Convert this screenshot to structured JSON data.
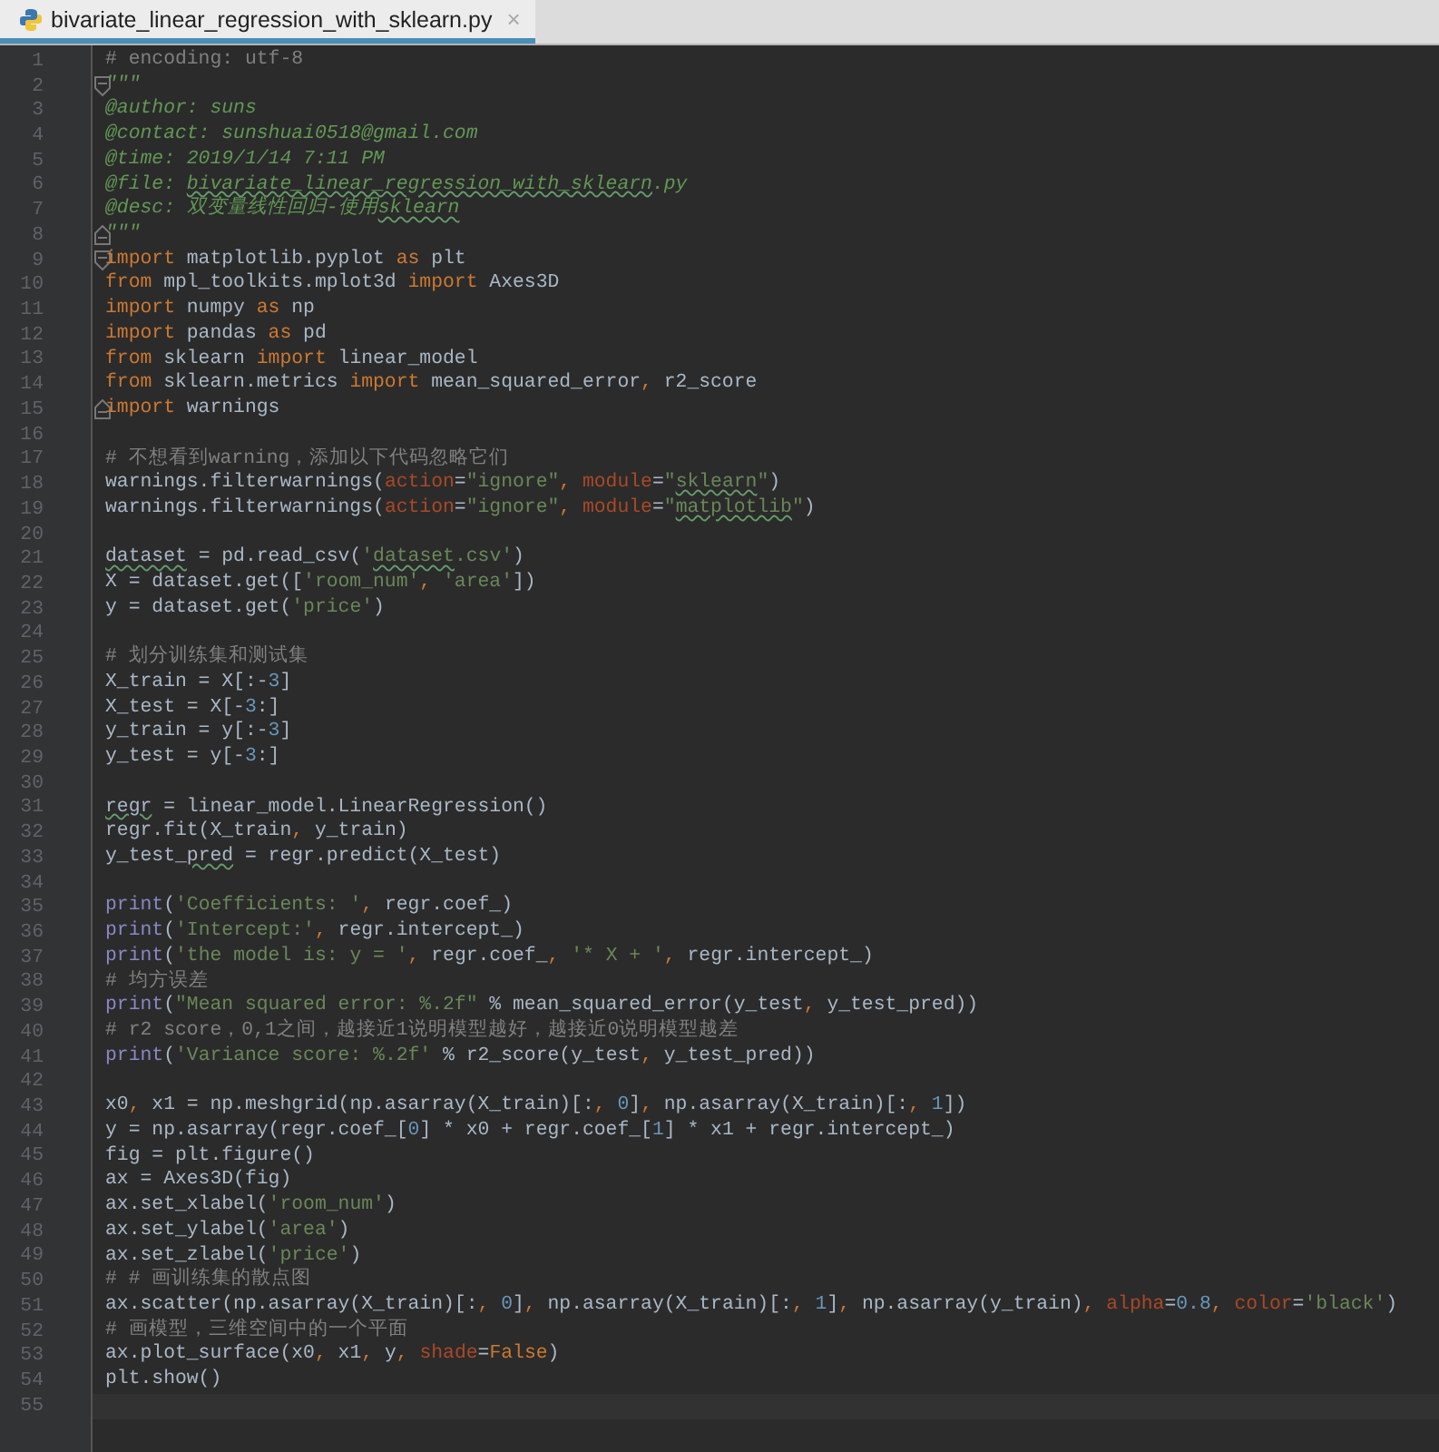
{
  "tabs": [
    {
      "label": "bivariate_linear_regression_with_sklearn.py",
      "close": "×",
      "selected": true
    }
  ],
  "lines": [
    {
      "n": "1",
      "tokens": [
        {
          "kind": "comment",
          "text": "# encoding: utf-8"
        }
      ]
    },
    {
      "n": "2",
      "fold_start": true,
      "tokens": [
        {
          "kind": "docstring",
          "text": "\"\"\""
        }
      ]
    },
    {
      "n": "3",
      "tokens": [
        {
          "kind": "docstring",
          "text": "@author: suns"
        }
      ]
    },
    {
      "n": "4",
      "tokens": [
        {
          "kind": "docstring",
          "text": "@contact: sunshuai0518@gmail.com"
        }
      ]
    },
    {
      "n": "5",
      "tokens": [
        {
          "kind": "docstring",
          "text": "@time: 2019/1/14 7:11 PM"
        }
      ]
    },
    {
      "n": "6",
      "tokens": [
        {
          "kind": "docstring",
          "text": "@file: "
        },
        {
          "kind": "docstring_typo",
          "text": "bivariate_linear_regression_with_sklearn"
        },
        {
          "kind": "docstring",
          "text": ".py"
        }
      ]
    },
    {
      "n": "7",
      "tokens": [
        {
          "kind": "docstring",
          "text": "@desc: 双变量线性回归-使用"
        },
        {
          "kind": "docstring_typo",
          "text": "sklearn"
        }
      ]
    },
    {
      "n": "8",
      "fold_end": true,
      "tokens": [
        {
          "kind": "docstring",
          "text": "\"\"\""
        }
      ]
    },
    {
      "n": "9",
      "fold_start": true,
      "tokens": [
        {
          "kind": "keyword",
          "text": "import"
        },
        {
          "kind": "plain",
          "text": " matplotlib.pyplot "
        },
        {
          "kind": "keyword",
          "text": "as"
        },
        {
          "kind": "plain",
          "text": " plt"
        }
      ]
    },
    {
      "n": "10",
      "tokens": [
        {
          "kind": "keyword",
          "text": "from"
        },
        {
          "kind": "plain",
          "text": " mpl_toolkits.mplot3d "
        },
        {
          "kind": "keyword",
          "text": "import"
        },
        {
          "kind": "plain",
          "text": " Axes3D"
        }
      ]
    },
    {
      "n": "11",
      "tokens": [
        {
          "kind": "keyword",
          "text": "import"
        },
        {
          "kind": "plain",
          "text": " numpy "
        },
        {
          "kind": "keyword",
          "text": "as"
        },
        {
          "kind": "plain",
          "text": " np"
        }
      ]
    },
    {
      "n": "12",
      "tokens": [
        {
          "kind": "keyword",
          "text": "import"
        },
        {
          "kind": "plain",
          "text": " pandas "
        },
        {
          "kind": "keyword",
          "text": "as"
        },
        {
          "kind": "plain",
          "text": " pd"
        }
      ]
    },
    {
      "n": "13",
      "tokens": [
        {
          "kind": "keyword",
          "text": "from"
        },
        {
          "kind": "plain",
          "text": " sklearn "
        },
        {
          "kind": "keyword",
          "text": "import"
        },
        {
          "kind": "plain",
          "text": " linear_model"
        }
      ]
    },
    {
      "n": "14",
      "tokens": [
        {
          "kind": "keyword",
          "text": "from"
        },
        {
          "kind": "plain",
          "text": " sklearn.metrics "
        },
        {
          "kind": "keyword",
          "text": "import"
        },
        {
          "kind": "plain",
          "text": " mean_squared_error"
        },
        {
          "kind": "keyword",
          "text": ","
        },
        {
          "kind": "plain",
          "text": " r2_score"
        }
      ]
    },
    {
      "n": "15",
      "fold_end": true,
      "tokens": [
        {
          "kind": "keyword",
          "text": "import"
        },
        {
          "kind": "plain",
          "text": " warnings"
        }
      ]
    },
    {
      "n": "16"
    },
    {
      "n": "17",
      "tokens": [
        {
          "kind": "comment",
          "text": "# 不想看到warning，添加以下代码忽略它们"
        }
      ]
    },
    {
      "n": "18",
      "tokens": [
        {
          "kind": "plain",
          "text": "warnings.filterwarnings("
        },
        {
          "kind": "param",
          "text": "action"
        },
        {
          "kind": "plain",
          "text": "="
        },
        {
          "kind": "string",
          "text": "\"ignore\""
        },
        {
          "kind": "keyword",
          "text": ", "
        },
        {
          "kind": "param",
          "text": "module"
        },
        {
          "kind": "plain",
          "text": "="
        },
        {
          "kind": "string",
          "text": "\""
        },
        {
          "kind": "string_typo",
          "text": "sklearn"
        },
        {
          "kind": "string",
          "text": "\""
        },
        {
          "kind": "plain",
          "text": ")"
        }
      ]
    },
    {
      "n": "19",
      "tokens": [
        {
          "kind": "plain",
          "text": "warnings.filterwarnings("
        },
        {
          "kind": "param",
          "text": "action"
        },
        {
          "kind": "plain",
          "text": "="
        },
        {
          "kind": "string",
          "text": "\"ignore\""
        },
        {
          "kind": "keyword",
          "text": ", "
        },
        {
          "kind": "param",
          "text": "module"
        },
        {
          "kind": "plain",
          "text": "="
        },
        {
          "kind": "string",
          "text": "\""
        },
        {
          "kind": "string_typo",
          "text": "matplotlib"
        },
        {
          "kind": "string",
          "text": "\""
        },
        {
          "kind": "plain",
          "text": ")"
        }
      ]
    },
    {
      "n": "20"
    },
    {
      "n": "21",
      "tokens": [
        {
          "kind": "plain_typo",
          "text": "dataset"
        },
        {
          "kind": "plain",
          "text": " = pd.read_csv("
        },
        {
          "kind": "string",
          "text": "'"
        },
        {
          "kind": "string_typo",
          "text": "dataset"
        },
        {
          "kind": "string",
          "text": ".csv'"
        },
        {
          "kind": "plain",
          "text": ")"
        }
      ]
    },
    {
      "n": "22",
      "tokens": [
        {
          "kind": "plain",
          "text": "X = dataset.get(["
        },
        {
          "kind": "string",
          "text": "'room_num'"
        },
        {
          "kind": "keyword",
          "text": ", "
        },
        {
          "kind": "string",
          "text": "'area'"
        },
        {
          "kind": "plain",
          "text": "])"
        }
      ]
    },
    {
      "n": "23",
      "tokens": [
        {
          "kind": "plain",
          "text": "y = dataset.get("
        },
        {
          "kind": "string",
          "text": "'price'"
        },
        {
          "kind": "plain",
          "text": ")"
        }
      ]
    },
    {
      "n": "24"
    },
    {
      "n": "25",
      "tokens": [
        {
          "kind": "comment",
          "text": "# 划分训练集和测试集"
        }
      ]
    },
    {
      "n": "26",
      "tokens": [
        {
          "kind": "plain",
          "text": "X_train = X[:-"
        },
        {
          "kind": "number",
          "text": "3"
        },
        {
          "kind": "plain",
          "text": "]"
        }
      ]
    },
    {
      "n": "27",
      "tokens": [
        {
          "kind": "plain",
          "text": "X_test = X[-"
        },
        {
          "kind": "number",
          "text": "3"
        },
        {
          "kind": "plain",
          "text": ":]"
        }
      ]
    },
    {
      "n": "28",
      "tokens": [
        {
          "kind": "plain",
          "text": "y_train = y[:-"
        },
        {
          "kind": "number",
          "text": "3"
        },
        {
          "kind": "plain",
          "text": "]"
        }
      ]
    },
    {
      "n": "29",
      "tokens": [
        {
          "kind": "plain",
          "text": "y_test = y[-"
        },
        {
          "kind": "number",
          "text": "3"
        },
        {
          "kind": "plain",
          "text": ":]"
        }
      ]
    },
    {
      "n": "30"
    },
    {
      "n": "31",
      "tokens": [
        {
          "kind": "plain_typo",
          "text": "regr"
        },
        {
          "kind": "plain",
          "text": " = linear_model.LinearRegression()"
        }
      ]
    },
    {
      "n": "32",
      "tokens": [
        {
          "kind": "plain",
          "text": "regr.fit(X_train"
        },
        {
          "kind": "keyword",
          "text": ","
        },
        {
          "kind": "plain",
          "text": " y_train)"
        }
      ]
    },
    {
      "n": "33",
      "tokens": [
        {
          "kind": "plain",
          "text": "y_test_"
        },
        {
          "kind": "plain_typo",
          "text": "pred"
        },
        {
          "kind": "plain",
          "text": " = regr.predict(X_test)"
        }
      ]
    },
    {
      "n": "34"
    },
    {
      "n": "35",
      "tokens": [
        {
          "kind": "builtin",
          "text": "print"
        },
        {
          "kind": "plain",
          "text": "("
        },
        {
          "kind": "string",
          "text": "'Coefficients: '"
        },
        {
          "kind": "keyword",
          "text": ","
        },
        {
          "kind": "plain",
          "text": " regr.coef_)"
        }
      ]
    },
    {
      "n": "36",
      "tokens": [
        {
          "kind": "builtin",
          "text": "print"
        },
        {
          "kind": "plain",
          "text": "("
        },
        {
          "kind": "string",
          "text": "'Intercept:'"
        },
        {
          "kind": "keyword",
          "text": ","
        },
        {
          "kind": "plain",
          "text": " regr.intercept_)"
        }
      ]
    },
    {
      "n": "37",
      "tokens": [
        {
          "kind": "builtin",
          "text": "print"
        },
        {
          "kind": "plain",
          "text": "("
        },
        {
          "kind": "string",
          "text": "'the model is: y = '"
        },
        {
          "kind": "keyword",
          "text": ","
        },
        {
          "kind": "plain",
          "text": " regr.coef_"
        },
        {
          "kind": "keyword",
          "text": ", "
        },
        {
          "kind": "string",
          "text": "'* X + '"
        },
        {
          "kind": "keyword",
          "text": ","
        },
        {
          "kind": "plain",
          "text": " regr.intercept_)"
        }
      ]
    },
    {
      "n": "38",
      "tokens": [
        {
          "kind": "comment",
          "text": "# 均方误差"
        }
      ]
    },
    {
      "n": "39",
      "tokens": [
        {
          "kind": "builtin",
          "text": "print"
        },
        {
          "kind": "plain",
          "text": "("
        },
        {
          "kind": "string",
          "text": "\"Mean squared error: %.2f\""
        },
        {
          "kind": "plain",
          "text": " % mean_squared_error(y_test"
        },
        {
          "kind": "keyword",
          "text": ","
        },
        {
          "kind": "plain",
          "text": " y_test_pred))"
        }
      ]
    },
    {
      "n": "40",
      "tokens": [
        {
          "kind": "comment",
          "text": "# r2 score，0,1之间，越接近1说明模型越好，越接近0说明模型越差"
        }
      ]
    },
    {
      "n": "41",
      "tokens": [
        {
          "kind": "builtin",
          "text": "print"
        },
        {
          "kind": "plain",
          "text": "("
        },
        {
          "kind": "string",
          "text": "'Variance score: %.2f'"
        },
        {
          "kind": "plain",
          "text": " % r2_score(y_test"
        },
        {
          "kind": "keyword",
          "text": ","
        },
        {
          "kind": "plain",
          "text": " y_test_pred))"
        }
      ]
    },
    {
      "n": "42"
    },
    {
      "n": "43",
      "tokens": [
        {
          "kind": "plain",
          "text": "x0"
        },
        {
          "kind": "keyword",
          "text": ","
        },
        {
          "kind": "plain",
          "text": " x1 = np.meshgrid(np.asarray(X_train)[:"
        },
        {
          "kind": "keyword",
          "text": ", "
        },
        {
          "kind": "number",
          "text": "0"
        },
        {
          "kind": "plain",
          "text": "]"
        },
        {
          "kind": "keyword",
          "text": ","
        },
        {
          "kind": "plain",
          "text": " np.asarray(X_train)[:"
        },
        {
          "kind": "keyword",
          "text": ", "
        },
        {
          "kind": "number",
          "text": "1"
        },
        {
          "kind": "plain",
          "text": "])"
        }
      ]
    },
    {
      "n": "44",
      "tokens": [
        {
          "kind": "plain",
          "text": "y = np.asarray(regr.coef_["
        },
        {
          "kind": "number",
          "text": "0"
        },
        {
          "kind": "plain",
          "text": "] * x0 + regr.coef_["
        },
        {
          "kind": "number",
          "text": "1"
        },
        {
          "kind": "plain",
          "text": "] * x1 + regr.intercept_)"
        }
      ]
    },
    {
      "n": "45",
      "tokens": [
        {
          "kind": "plain",
          "text": "fig = plt.figure()"
        }
      ]
    },
    {
      "n": "46",
      "tokens": [
        {
          "kind": "plain",
          "text": "ax = Axes3D(fig)"
        }
      ]
    },
    {
      "n": "47",
      "tokens": [
        {
          "kind": "plain",
          "text": "ax.set_xlabel("
        },
        {
          "kind": "string",
          "text": "'room_num'"
        },
        {
          "kind": "plain",
          "text": ")"
        }
      ]
    },
    {
      "n": "48",
      "tokens": [
        {
          "kind": "plain",
          "text": "ax.set_ylabel("
        },
        {
          "kind": "string",
          "text": "'area'"
        },
        {
          "kind": "plain",
          "text": ")"
        }
      ]
    },
    {
      "n": "49",
      "tokens": [
        {
          "kind": "plain",
          "text": "ax.set_zlabel("
        },
        {
          "kind": "string",
          "text": "'price'"
        },
        {
          "kind": "plain",
          "text": ")"
        }
      ]
    },
    {
      "n": "50",
      "tokens": [
        {
          "kind": "comment",
          "text": "# # 画训练集的散点图"
        }
      ]
    },
    {
      "n": "51",
      "tokens": [
        {
          "kind": "plain",
          "text": "ax.scatter(np.asarray(X_train)[:"
        },
        {
          "kind": "keyword",
          "text": ", "
        },
        {
          "kind": "number",
          "text": "0"
        },
        {
          "kind": "plain",
          "text": "]"
        },
        {
          "kind": "keyword",
          "text": ","
        },
        {
          "kind": "plain",
          "text": " np.asarray(X_train)[:"
        },
        {
          "kind": "keyword",
          "text": ", "
        },
        {
          "kind": "number",
          "text": "1"
        },
        {
          "kind": "plain",
          "text": "]"
        },
        {
          "kind": "keyword",
          "text": ","
        },
        {
          "kind": "plain",
          "text": " np.asarray(y_train)"
        },
        {
          "kind": "keyword",
          "text": ", "
        },
        {
          "kind": "param",
          "text": "alpha"
        },
        {
          "kind": "plain",
          "text": "="
        },
        {
          "kind": "number",
          "text": "0.8"
        },
        {
          "kind": "keyword",
          "text": ", "
        },
        {
          "kind": "param",
          "text": "color"
        },
        {
          "kind": "plain",
          "text": "="
        },
        {
          "kind": "string",
          "text": "'black'"
        },
        {
          "kind": "plain",
          "text": ")"
        }
      ]
    },
    {
      "n": "52",
      "tokens": [
        {
          "kind": "comment",
          "text": "# 画模型，三维空间中的一个平面"
        }
      ]
    },
    {
      "n": "53",
      "tokens": [
        {
          "kind": "plain",
          "text": "ax.plot_surface(x0"
        },
        {
          "kind": "keyword",
          "text": ","
        },
        {
          "kind": "plain",
          "text": " x1"
        },
        {
          "kind": "keyword",
          "text": ","
        },
        {
          "kind": "plain",
          "text": " y"
        },
        {
          "kind": "keyword",
          "text": ", "
        },
        {
          "kind": "param",
          "text": "shade"
        },
        {
          "kind": "plain",
          "text": "="
        },
        {
          "kind": "keyword",
          "text": "False"
        },
        {
          "kind": "plain",
          "text": ")"
        }
      ]
    },
    {
      "n": "54",
      "tokens": [
        {
          "kind": "plain",
          "text": "plt.show()"
        }
      ]
    },
    {
      "n": "55",
      "current": true
    }
  ]
}
